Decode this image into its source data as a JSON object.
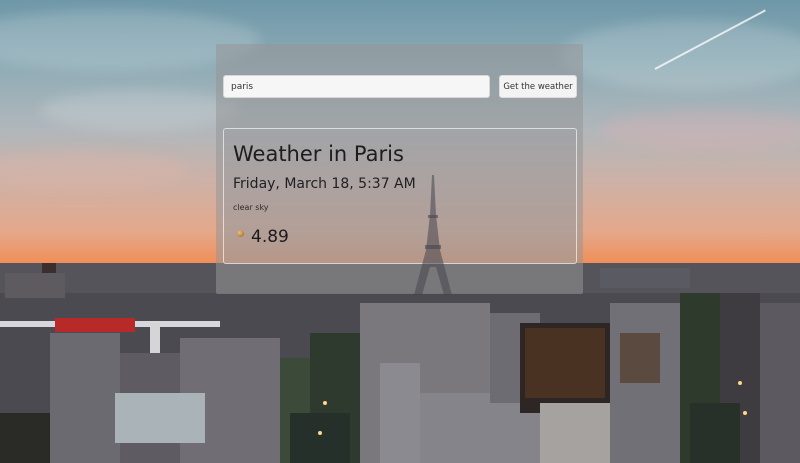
{
  "search": {
    "value": "paris",
    "placeholder": "",
    "button_label": "Get the weather"
  },
  "weather": {
    "title": "Weather in Paris",
    "datetime": "Friday, March 18, 5:37 AM",
    "description": "clear sky",
    "temperature": "4.89",
    "icon": "clear-sky-moon-icon"
  },
  "background": {
    "scene": "paris-city-sunset-skyline",
    "colors": {
      "sky_top": "#6e97a8",
      "horizon": "#f47f3e",
      "city": "#3f3e42"
    }
  }
}
